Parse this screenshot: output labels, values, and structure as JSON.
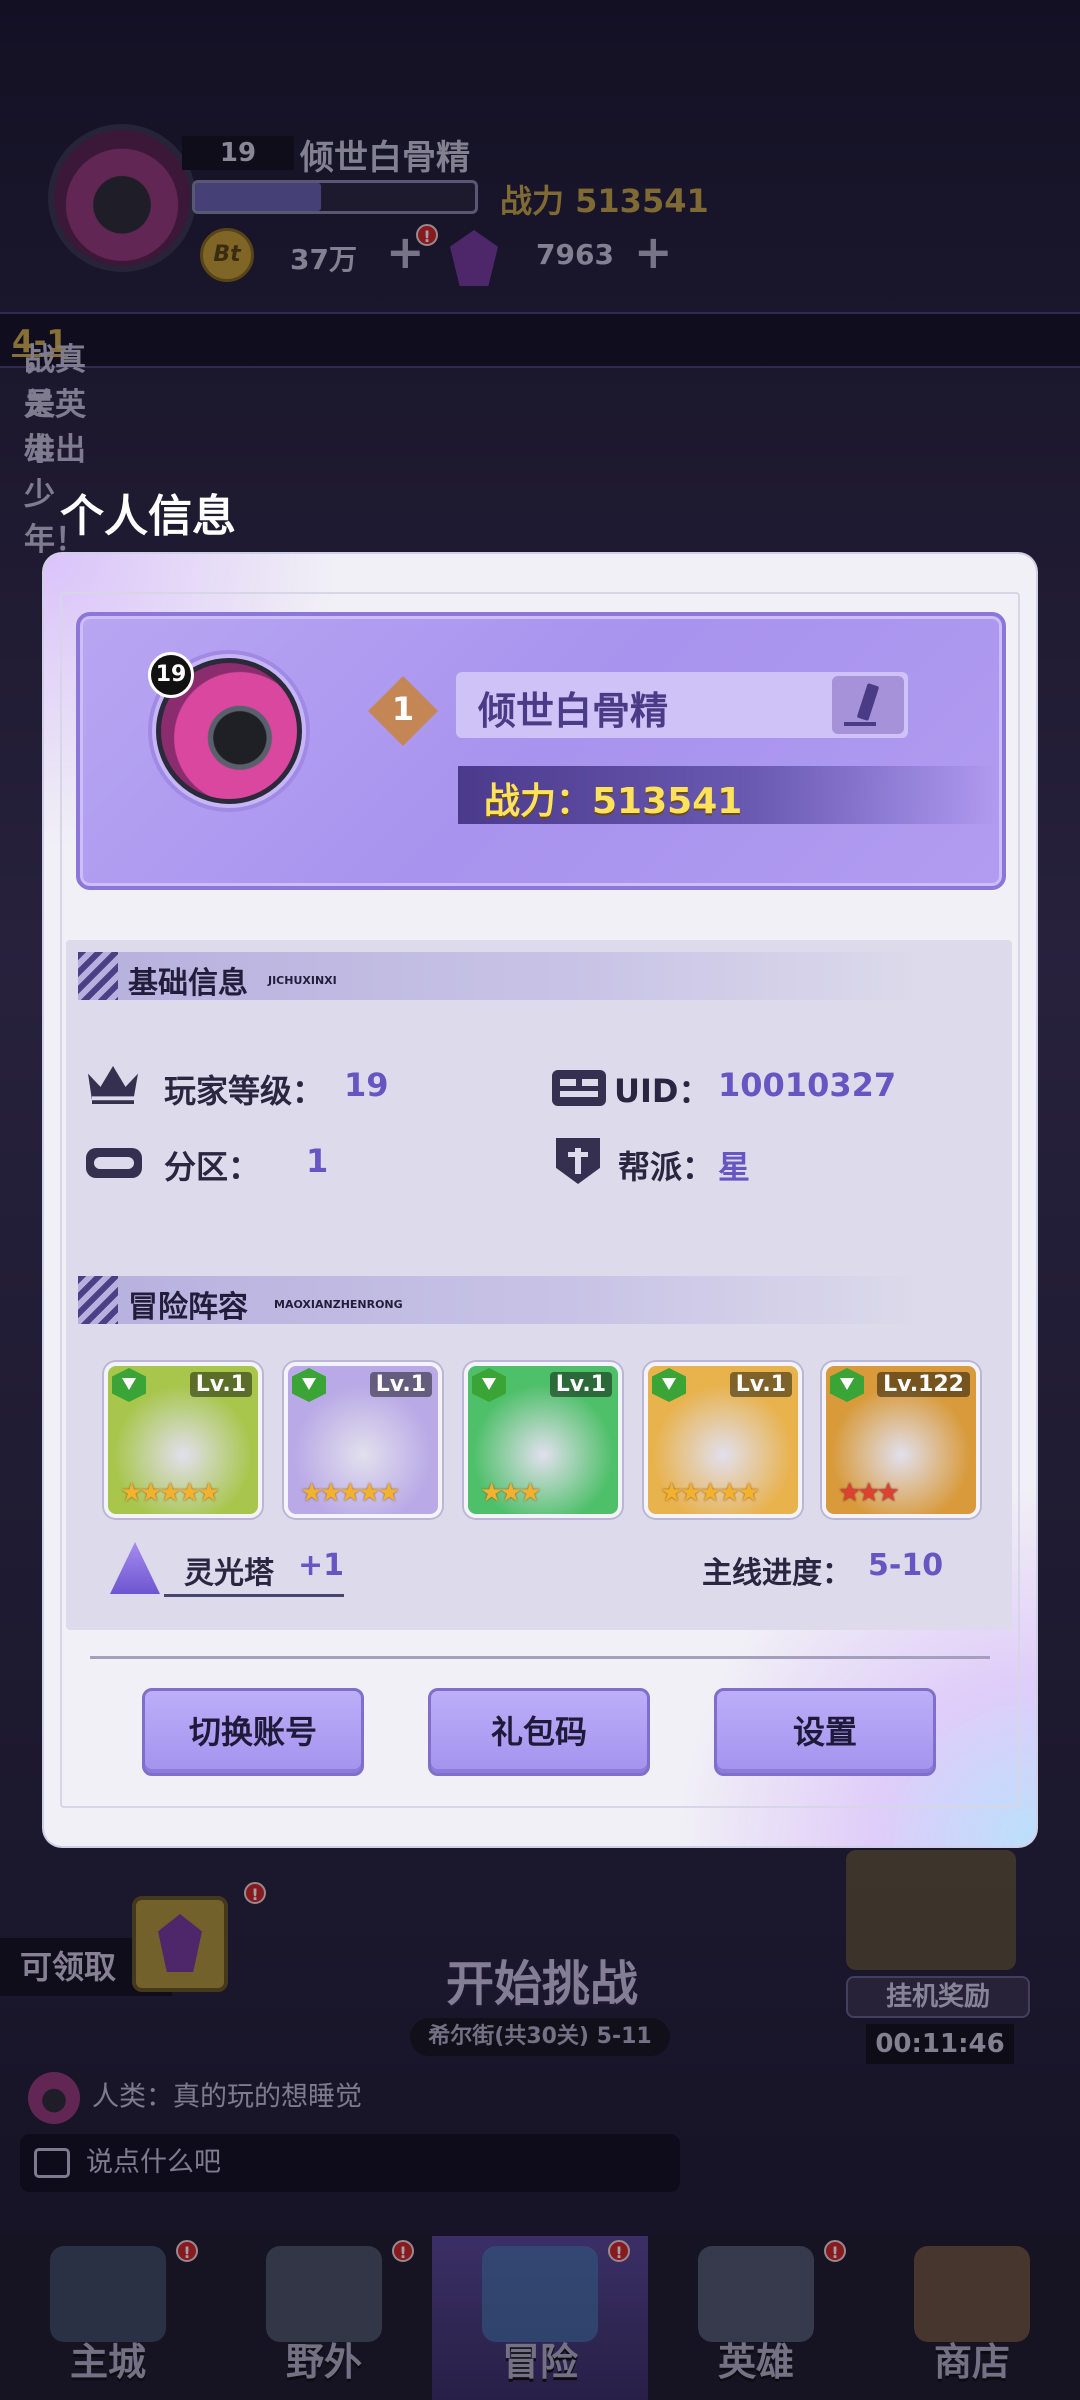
{
  "hud": {
    "level": "19",
    "name": "倾世白骨精",
    "exp_fraction": 0.45,
    "power_text": "战力 513541",
    "coin_icon_text": "Bt",
    "coins": "37万",
    "gems": "7963",
    "plus": "+",
    "alert": "!"
  },
  "marquee": {
    "prefix": "战关卡",
    "stage": "4-1",
    "suffix": "，真是英雄出少年！"
  },
  "modal": {
    "title": "个人信息",
    "profile": {
      "level_badge": "19",
      "rank": "1",
      "name": "倾世白骨精",
      "power": "战力：513541"
    },
    "basic": {
      "title": "基础信息",
      "subtitle": "JICHUXINXI",
      "player_level_label": "玩家等级：",
      "player_level": "19",
      "uid_label": "UID：",
      "uid": "10010327",
      "zone_label": "分区：",
      "zone": "1",
      "guild_label": "帮派：",
      "guild": "星"
    },
    "lineup": {
      "title": "冒险阵容",
      "subtitle": "MAOXIANZHENRONG",
      "heroes": [
        {
          "level": "Lv.1",
          "stars": "★★★★★",
          "bg": "#a7c64b"
        },
        {
          "level": "Lv.1",
          "stars": "★★★★★",
          "bg": "#b9a9e6"
        },
        {
          "level": "Lv.1",
          "stars": "★★★",
          "bg": "#4fc06a"
        },
        {
          "level": "Lv.1",
          "stars": "★★★★★",
          "bg": "#e8b24d"
        },
        {
          "level": "Lv.122",
          "stars": "★★★",
          "bg": "#d89a3a"
        }
      ],
      "tower_label": "灵光塔",
      "tower_bonus": "+1",
      "progress_label": "主线进度：",
      "progress": "5-10"
    },
    "buttons": {
      "switch_account": "切换账号",
      "gift_code": "礼包码",
      "settings": "设置"
    }
  },
  "bottom": {
    "claim_label": "可领取",
    "start_challenge": "开始挑战",
    "stage_info": "希尔街(共30关) 5-11",
    "idle_reward": "挂机奖励",
    "idle_time": "00:11:46",
    "chat_message": "人类：真的玩的想睡觉",
    "chat_placeholder": "说点什么吧"
  },
  "nav": {
    "items": [
      {
        "label": "主城",
        "alert": "!"
      },
      {
        "label": "野外",
        "alert": "!"
      },
      {
        "label": "冒险",
        "alert": "!"
      },
      {
        "label": "英雄",
        "alert": "!"
      },
      {
        "label": "商店",
        "alert": ""
      }
    ],
    "active_index": 2
  },
  "colors": {
    "accent": "#6756c2",
    "profile_card": "#b8a6f2",
    "button": "#a393ee",
    "power_text": "#ffe25c"
  }
}
